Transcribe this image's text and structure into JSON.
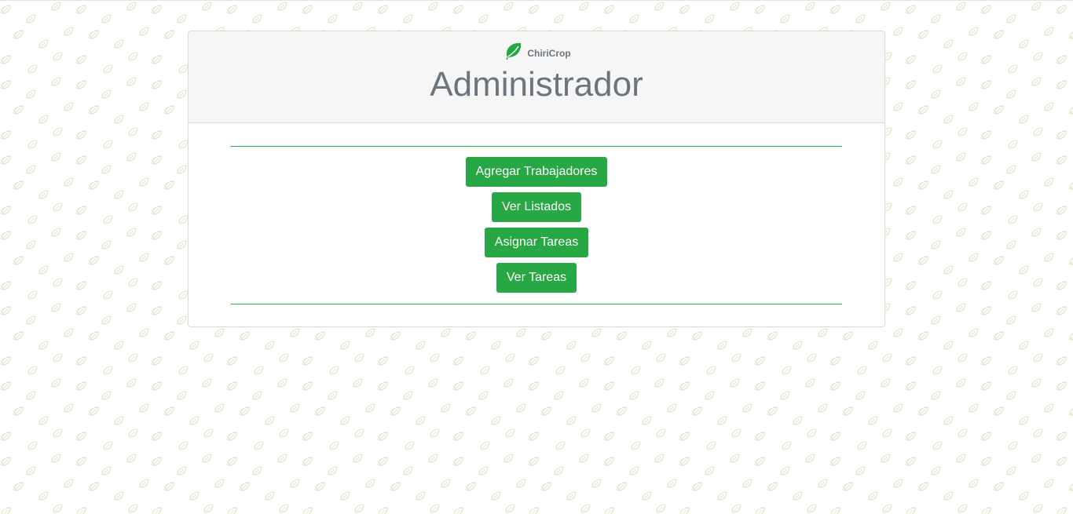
{
  "header": {
    "brand_name": "ChiriCrop",
    "brand_icon": "leaf-icon",
    "title": "Administrador"
  },
  "actions": [
    {
      "label": "Agregar Trabajadores"
    },
    {
      "label": "Ver Listados"
    },
    {
      "label": "Asignar Tareas"
    },
    {
      "label": "Ver Tareas"
    }
  ],
  "colors": {
    "accent": "#28a745",
    "title_text": "#6c757d",
    "header_bg": "#f6f6f6",
    "pattern_leaf": "#dfe9c5"
  },
  "background": {
    "pattern_icon": "leaf-icon"
  }
}
